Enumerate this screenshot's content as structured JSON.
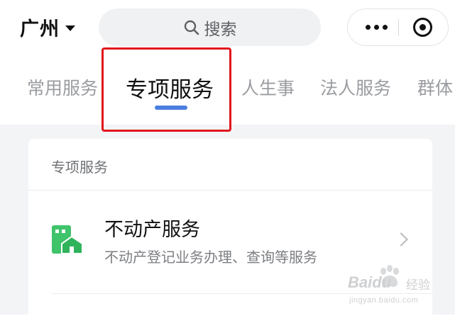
{
  "header": {
    "city": "广州",
    "search_placeholder": "搜索"
  },
  "tabs": [
    {
      "label": "常用服务",
      "active": false
    },
    {
      "label": "专项服务",
      "active": true
    },
    {
      "label": "人生事",
      "active": false
    },
    {
      "label": "法人服务",
      "active": false
    },
    {
      "label": "群体",
      "active": false
    }
  ],
  "section": {
    "title": "专项服务",
    "services": [
      {
        "title": "不动产服务",
        "description": "不动产登记业务办理、查询等服务",
        "icon": "house-building-icon"
      }
    ]
  },
  "colors": {
    "accent": "#4a7ee0",
    "highlight": "#e1161d",
    "icon_green": "#3fc36b"
  },
  "watermark": {
    "brand": "Baidu",
    "brand_cn": "经验",
    "url": "jingyan.baidu.com"
  }
}
